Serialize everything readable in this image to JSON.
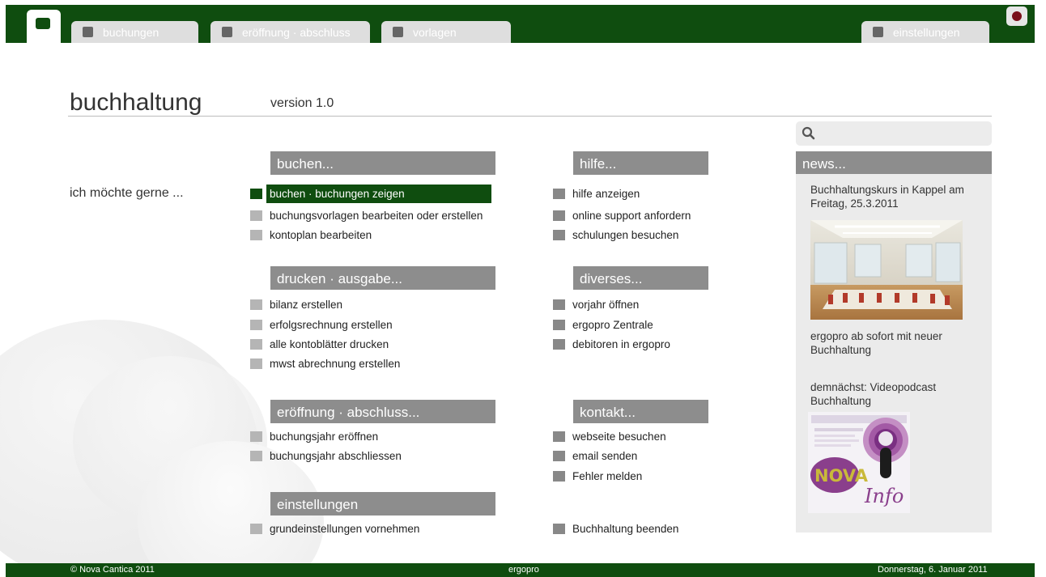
{
  "topbar": {
    "tabs": [
      {
        "label": "buchungen"
      },
      {
        "label": "eröffnung · abschluss"
      },
      {
        "label": "vorlagen"
      }
    ],
    "settings_tab": {
      "label": "einstellungen"
    }
  },
  "header": {
    "title": "buchhaltung",
    "version": "version 1.0"
  },
  "intro": "ich möchte gerne ...",
  "sections": {
    "buchen": {
      "title": "buchen...",
      "items": [
        "buchen · buchungen zeigen",
        "buchungsvorlagen bearbeiten oder erstellen",
        "kontoplan bearbeiten"
      ]
    },
    "drucken": {
      "title": "drucken · ausgabe...",
      "items": [
        "bilanz erstellen",
        "erfolgsrechnung erstellen",
        "alle kontoblätter drucken",
        "mwst abrechnung erstellen"
      ]
    },
    "eroeffnung": {
      "title": "eröffnung · abschluss...",
      "items": [
        "buchungsjahr eröffnen",
        "buchungsjahr abschliessen"
      ]
    },
    "einstellungen": {
      "title": "einstellungen",
      "items": [
        "grundeinstellungen vornehmen"
      ]
    },
    "hilfe": {
      "title": "hilfe...",
      "items": [
        "hilfe anzeigen",
        "online support anfordern",
        "schulungen besuchen"
      ]
    },
    "diverses": {
      "title": "diverses...",
      "items": [
        "vorjahr öffnen",
        "ergopro Zentrale",
        "debitoren in ergopro"
      ]
    },
    "kontakt": {
      "title": "kontakt...",
      "items": [
        "webseite besuchen",
        "email senden",
        "Fehler melden"
      ]
    },
    "quit": {
      "label": "Buchhaltung beenden"
    }
  },
  "news": {
    "title": "news...",
    "items": [
      {
        "text": "Buchhaltungskurs in Kappel am Freitag, 25.3.2011"
      },
      {
        "text": "ergopro ab sofort mit neuer Buchhaltung"
      },
      {
        "text": "demnächst: Videopodcast Buchhaltung"
      }
    ],
    "podcast_logo": "NovaInfo"
  },
  "footer": {
    "copyright": "© Nova Cantica 2011",
    "center": "ergopro",
    "date": "Donnerstag, 6. Januar 2011"
  },
  "colors": {
    "brand_green": "#0f4d0f",
    "section_gray": "#8d8d8d",
    "panel_gray": "#ebebeb",
    "power_red": "#7a0f1a"
  },
  "icons": [
    "home-icon",
    "power-icon",
    "search-icon"
  ]
}
